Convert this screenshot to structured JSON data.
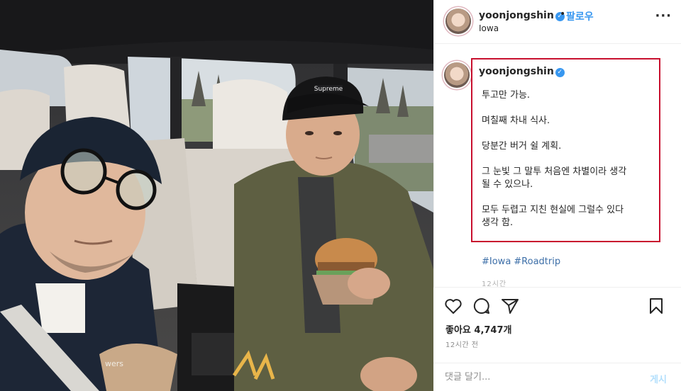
{
  "post": {
    "username": "yoonjongshin",
    "verified_mark": "✓",
    "separator": "•",
    "follow_label": "팔로우",
    "location": "Iowa",
    "more_label": "···",
    "caption": {
      "username": "yoonjongshin",
      "lines": [
        "투고만 가능.",
        "며칠째 차내 식사.",
        "당분간 버거 쉴 계획.",
        "그 눈빛 그 말투 처음엔 차별이라 생각\n될 수 있으나.",
        "모두 두렵고 지친 현실에 그럴수 있다\n생각 함."
      ]
    },
    "hashtags": [
      "#Iowa",
      "#Roadtrip"
    ],
    "caption_time": "12시간",
    "likes": "좋아요 4,747개",
    "posted_time": "12시간 전",
    "comment_placeholder": "댓글 달기...",
    "post_button": "게시"
  },
  "icons": {
    "heart": "heart-icon",
    "comment": "comment-icon",
    "share": "share-icon",
    "bookmark": "bookmark-icon"
  },
  "colors": {
    "highlight_border": "#c8102e",
    "link_blue": "#3897f0",
    "hashtag": "#3d6fa8"
  },
  "photo": {
    "cap_logo_text": "Supreme",
    "shirt_text": "wers"
  }
}
